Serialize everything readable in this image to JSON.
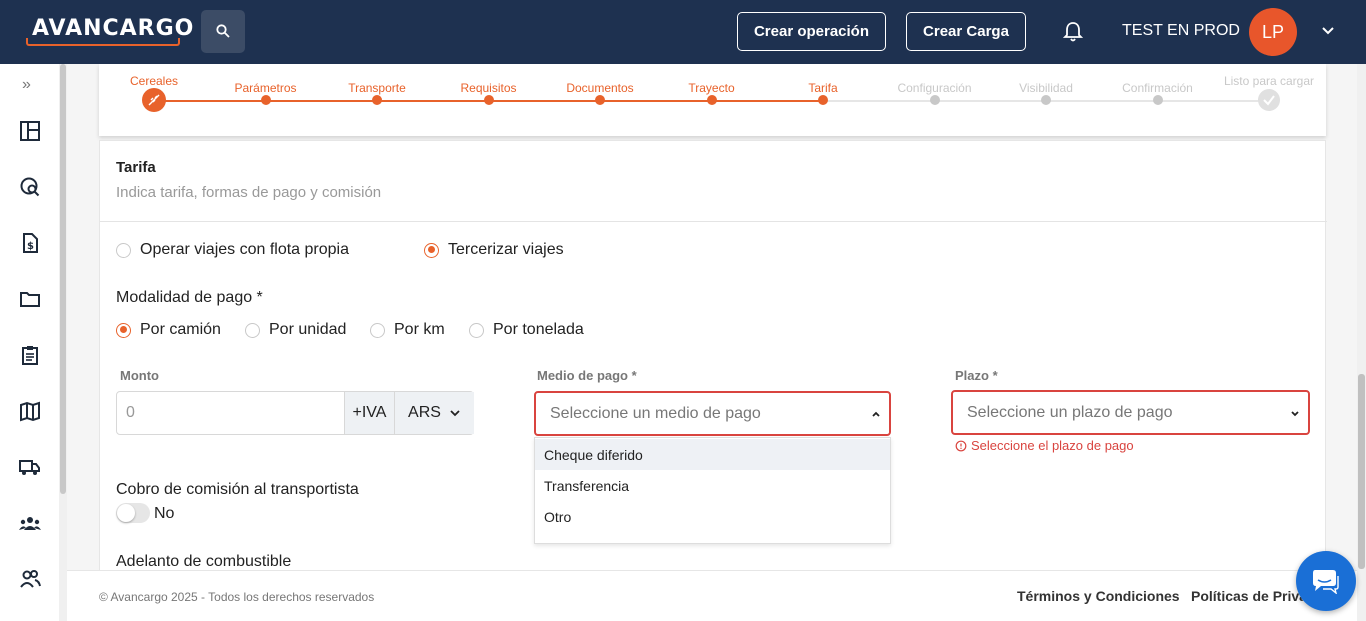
{
  "header": {
    "logo": "AVANCARGO",
    "create_operation": "Crear operación",
    "create_load": "Crear Carga",
    "user_name": "TEST EN PROD",
    "avatar_initials": "LP"
  },
  "stepper": {
    "steps": [
      {
        "label": "Cereales",
        "state": "current"
      },
      {
        "label": "Parámetros",
        "state": "done"
      },
      {
        "label": "Transporte",
        "state": "done"
      },
      {
        "label": "Requisitos",
        "state": "done"
      },
      {
        "label": "Documentos",
        "state": "done"
      },
      {
        "label": "Trayecto",
        "state": "done"
      },
      {
        "label": "Tarifa",
        "state": "done"
      },
      {
        "label": "Configuración",
        "state": "pending"
      },
      {
        "label": "Visibilidad",
        "state": "pending"
      },
      {
        "label": "Confirmación",
        "state": "pending"
      },
      {
        "label": "Listo para cargar",
        "state": "pending"
      }
    ]
  },
  "section": {
    "title": "Tarifa",
    "subtitle": "Indica tarifa, formas de pago y comisión"
  },
  "fleet_options": [
    {
      "label": "Operar viajes con flota propia",
      "checked": false
    },
    {
      "label": "Tercerizar viajes",
      "checked": true
    }
  ],
  "payment_mode": {
    "label": "Modalidad de pago *",
    "options": [
      {
        "label": "Por camión",
        "checked": true
      },
      {
        "label": "Por unidad",
        "checked": false
      },
      {
        "label": "Por km",
        "checked": false
      },
      {
        "label": "Por tonelada",
        "checked": false
      }
    ]
  },
  "monto": {
    "label": "Monto",
    "value": "0",
    "iva": "+IVA",
    "currency": "ARS"
  },
  "medio_pago": {
    "label": "Medio de pago *",
    "placeholder": "Seleccione un medio de pago",
    "options": [
      "Cheque diferido",
      "Transferencia",
      "Otro"
    ]
  },
  "plazo": {
    "label": "Plazo *",
    "placeholder": "Seleccione un plazo de pago",
    "error": "Seleccione el plazo de pago"
  },
  "commission": {
    "label": "Cobro de comisión al transportista",
    "toggle_label": "No"
  },
  "fuel_advance": {
    "label": "Adelanto de combustible"
  },
  "footer": {
    "copyright": "© Avancargo 2025 - Todos los derechos reservados",
    "terms": "Términos y Condiciones",
    "privacy": "Políticas de Priva"
  },
  "colors": {
    "brand_navy": "#1e3150",
    "accent_orange": "#e8622b",
    "error_red": "#d9443f",
    "chat_blue": "#1a6fd6"
  }
}
